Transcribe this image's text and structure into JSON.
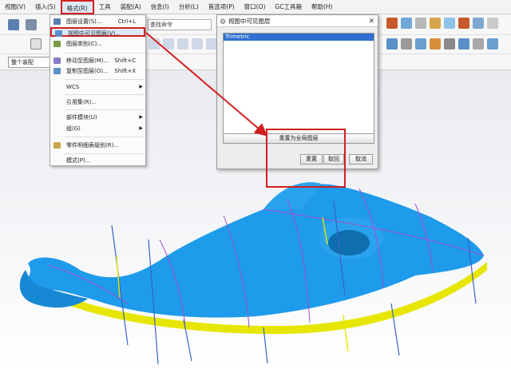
{
  "menubar": {
    "items": [
      "视图(V)",
      "插入(S)",
      "格式(R)",
      "工具",
      "装配(A)",
      "信息(I)",
      "分析(L)",
      "首选项(P)",
      "窗口(O)",
      "GC工具箱",
      "帮助(H)"
    ],
    "active": "格式(R)"
  },
  "toolbar": {
    "search_placeholder": "查找命令",
    "filter_value": "整个装配"
  },
  "format_menu": {
    "items": [
      {
        "label": "图层设置(S)...",
        "shortcut": "Ctrl+L",
        "icon": "layer-settings-icon"
      },
      {
        "label": "视图中可见图层(V)...",
        "shortcut": "",
        "icon": "visible-layers-icon",
        "highlighted": true
      },
      {
        "label": "图层类别(C)...",
        "shortcut": "",
        "icon": "layer-category-icon"
      },
      {
        "label": "移动至图层(M)...",
        "shortcut": "Shift+C",
        "icon": "move-to-layer-icon"
      },
      {
        "label": "复制至图层(O)...",
        "shortcut": "Shift+X",
        "icon": "copy-to-layer-icon"
      },
      {
        "label": "WCS",
        "submenu": true
      },
      {
        "label": "引用集(R)...",
        "submenu": false
      },
      {
        "label": "部件模块(U)",
        "submenu": true
      },
      {
        "label": "组(G)",
        "submenu": true
      },
      {
        "label": "零件明细表级别(R)...",
        "icon": "parts-list-icon"
      },
      {
        "label": "模式(P)...",
        "submenu": false
      }
    ]
  },
  "dialog": {
    "title": "视图中可见图层",
    "list_items": [
      "Trimetric"
    ],
    "reset_global_label": "重置为全局图层",
    "apply_label": "重置",
    "cancel_label": "取消",
    "close_label": "取回"
  },
  "colors": {
    "highlight_red": "#d21f1f",
    "model_blue": "#1e9bea",
    "model_yellow": "#e6e600",
    "selection_blue": "#2f6fd1"
  }
}
